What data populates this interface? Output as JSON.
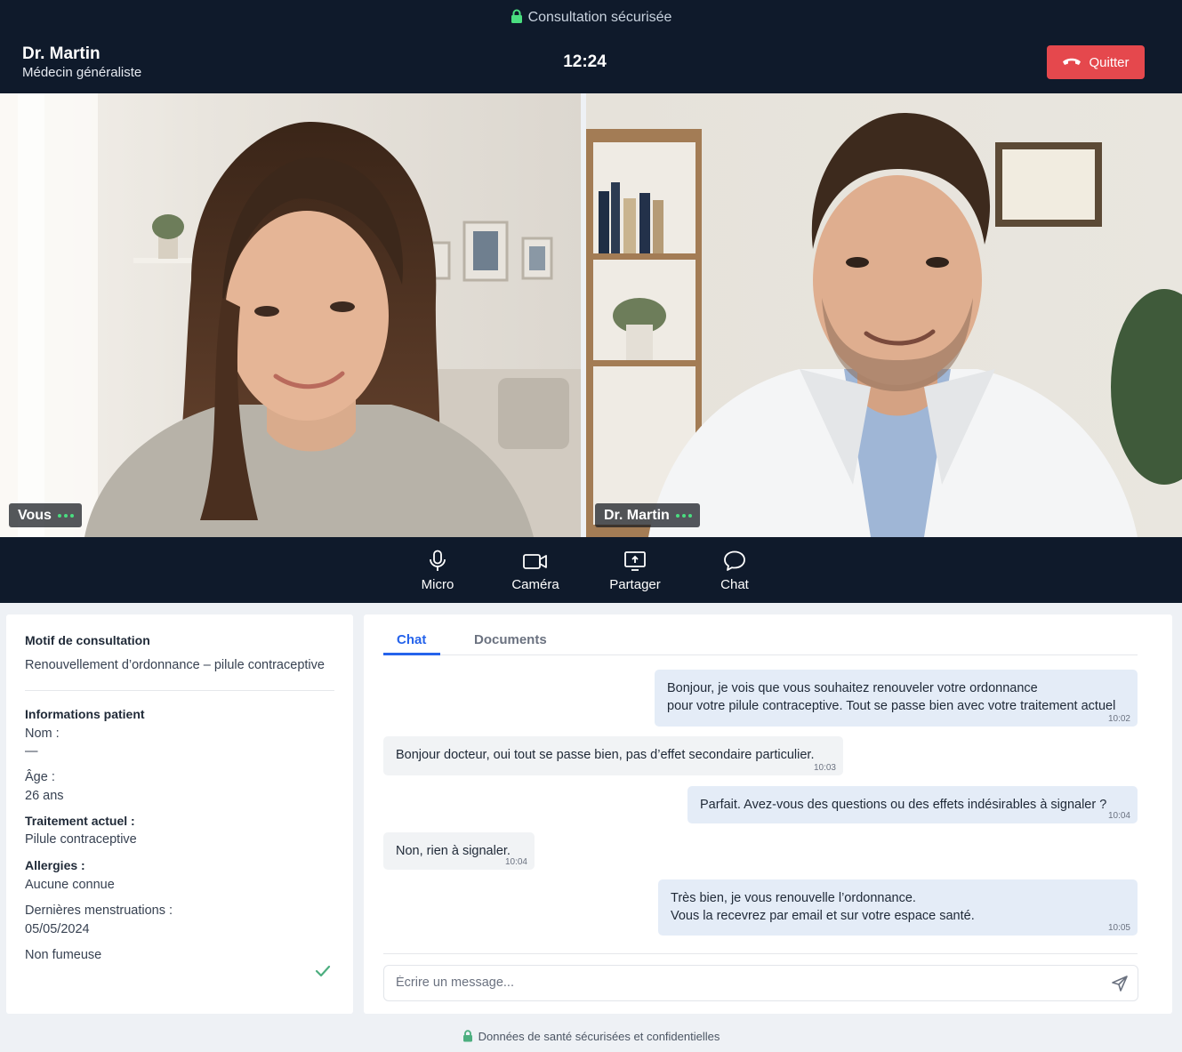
{
  "header": {
    "secure_label": "Consultation sécurisée",
    "doctor_name": "Dr. Martin",
    "doctor_role": "Médecin généraliste",
    "timer": "12:24",
    "quit_label": "Quitter",
    "quit_color": "#e5484d",
    "background": "#0f1a2b"
  },
  "videos": {
    "self_label": "Vous",
    "remote_label": "Dr. Martin",
    "status_color": "#4ade80"
  },
  "controls": [
    {
      "label": "Micro",
      "icon": "microphone-icon"
    },
    {
      "label": "Caméra",
      "icon": "camera-icon"
    },
    {
      "label": "Partager",
      "icon": "share-screen-icon"
    },
    {
      "label": "Chat",
      "icon": "chat-bubble-icon"
    }
  ],
  "info": {
    "reason_title": "Motif de consultation",
    "reason_value": "Renouvellement d’ordonnance – pilule contraceptive",
    "patient_title": "Informations patient",
    "name_label": "Nom :",
    "name_value": "—",
    "age_label": "Âge :",
    "age_value": "26 ans",
    "treatment_label": "Traitement actuel :",
    "treatment_value": "Pilule contraceptive",
    "allergies_label": "Allergies :",
    "allergies_value": "Aucune connue",
    "period_label": "Dernières menstruations :",
    "period_value": "05/05/2024",
    "smoker": "Non fumeuse"
  },
  "chat": {
    "tabs": [
      "Chat",
      "Documents"
    ],
    "active_tab": "Chat",
    "messages": [
      {
        "from": "doctor",
        "lines": [
          "Bonjour, je vois que vous souhaitez renouveler votre ordonnance",
          "pour votre pilule contraceptive. Tout se passe bien avec votre traitement actuel"
        ],
        "time": "10:02"
      },
      {
        "from": "patient",
        "lines": [
          "Bonjour docteur, oui tout se passe bien, pas d’effet secondaire particulier."
        ],
        "time": "10:03"
      },
      {
        "from": "doctor",
        "lines": [
          "Parfait. Avez-vous des questions ou des effets indésirables à signaler ?"
        ],
        "time": "10:04"
      },
      {
        "from": "patient",
        "lines": [
          "Non, rien à signaler."
        ],
        "time": "10:04"
      },
      {
        "from": "doctor",
        "lines": [
          "Très bien, je vous renouvelle l’ordonnance.",
          "Vous la recevrez par email et sur votre espace santé."
        ],
        "time": "10:05"
      }
    ],
    "input_placeholder": "Écrire un message..."
  },
  "footer": {
    "text": "Données de santé sécurisées et confidentielles"
  }
}
